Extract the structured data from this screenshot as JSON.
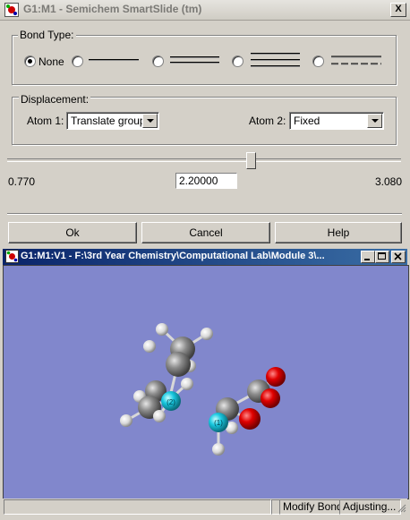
{
  "dialog": {
    "title": "G1:M1 - Semichem SmartSlide (tm)",
    "close_label": "X",
    "bond_type": {
      "legend": "Bond Type:",
      "options": [
        {
          "label": "None",
          "selected": true,
          "lines": 0
        },
        {
          "label": "",
          "selected": false,
          "lines": 1
        },
        {
          "label": "",
          "selected": false,
          "lines": 2
        },
        {
          "label": "",
          "selected": false,
          "lines": 3
        },
        {
          "label": "",
          "selected": false,
          "lines": "dashed"
        }
      ]
    },
    "displacement": {
      "legend": "Displacement:",
      "atom1_label": "Atom 1:",
      "atom1_value": "Translate group",
      "atom2_label": "Atom 2:",
      "atom2_value": "Fixed"
    },
    "slider": {
      "min_label": "0.770",
      "max_label": "3.080",
      "value": "2.20000",
      "min": 0.77,
      "max": 3.08,
      "current": 2.2
    },
    "buttons": {
      "ok": "Ok",
      "cancel": "Cancel",
      "help": "Help"
    }
  },
  "viewer": {
    "title": "G1:M1:V1 - F:\\3rd Year Chemistry\\Computational Lab\\Module 3\\...",
    "background": "#8187cc",
    "atom_labels": {
      "a1": "(1)",
      "a2": "(2)"
    },
    "status": {
      "cell1": "",
      "cell2": "",
      "mode": "Modify Bond",
      "state": "Adjusting..."
    }
  },
  "colors": {
    "carbon": "#7a7a7a",
    "hydrogen": "#e8e8e8",
    "oxygen": "#e01010",
    "nitrogen": "#20c8d8",
    "viewer_bg": "#8187cc"
  }
}
